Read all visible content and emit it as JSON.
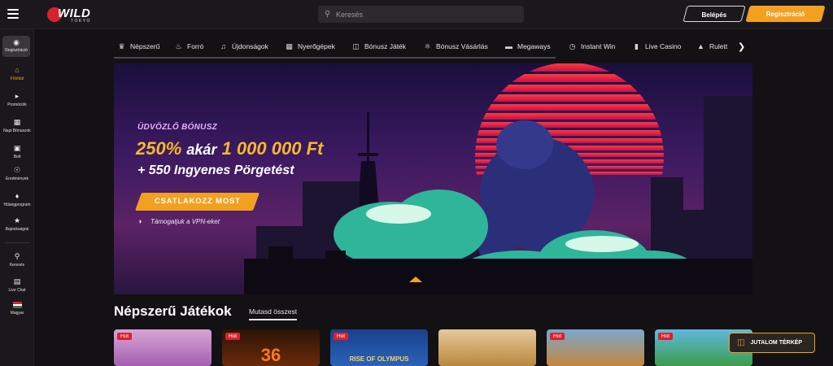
{
  "header": {
    "logo_main": "WILD",
    "logo_sub": "TOKYO",
    "search_placeholder": "Keresés",
    "login_label": "Belépés",
    "register_label": "Regisztráció"
  },
  "sidebar": {
    "register": "Regisztráció",
    "items": [
      {
        "label": "Főoldal",
        "icon": "home-icon",
        "active": true
      },
      {
        "label": "Promóciók",
        "icon": "megaphone-icon"
      },
      {
        "label": "Napi Bónuszok",
        "icon": "calendar-icon"
      },
      {
        "label": "Bolt",
        "icon": "shop-icon"
      },
      {
        "label": "Eredmények",
        "icon": "achievements-icon"
      },
      {
        "label": "Hűségprogram",
        "icon": "loyalty-icon"
      },
      {
        "label": "Bajnokságok",
        "icon": "trophy-icon"
      }
    ],
    "lower": [
      {
        "label": "Keresés",
        "icon": "search-icon"
      },
      {
        "label": "Live Chat",
        "icon": "chat-icon"
      },
      {
        "label": "Magyar",
        "icon": "hungary-flag-icon"
      }
    ]
  },
  "categories": [
    {
      "label": "Népszerű",
      "icon": "crown-icon"
    },
    {
      "label": "Forró",
      "icon": "flame-icon"
    },
    {
      "label": "Újdonságok",
      "icon": "bell-icon"
    },
    {
      "label": "Nyerőgépek",
      "icon": "slot-icon"
    },
    {
      "label": "Bónusz Játék",
      "icon": "gift-icon"
    },
    {
      "label": "Bónusz Vásárlás",
      "icon": "bonus-buy-icon"
    },
    {
      "label": "Megaways",
      "icon": "megaways-icon"
    },
    {
      "label": "Instant Win",
      "icon": "timer-icon"
    },
    {
      "label": "Live Casino",
      "icon": "live-casino-icon"
    },
    {
      "label": "Rulett",
      "icon": "roulette-icon"
    }
  ],
  "banner": {
    "welcome": "ÜDVÖZLŐ BÓNUSZ",
    "amount": "250%",
    "up_to": "akár",
    "prize": "1 000 000 Ft",
    "spins": "+ 550 Ingyenes Pörgetést",
    "cta": "CSATLAKOZZ MOST",
    "vpn": "Támogatjuk a VPN-eket"
  },
  "popular": {
    "title": "Népszerű Játékok",
    "show_all": "Mutasd összest",
    "games": [
      {
        "badge": "Hot",
        "caption": ""
      },
      {
        "badge": "Hot",
        "caption": "36"
      },
      {
        "badge": "Hot",
        "caption": "RISE OF OLYMPUS"
      },
      {
        "badge": "",
        "caption": ""
      },
      {
        "badge": "Hot",
        "caption": ""
      },
      {
        "badge": "Hot",
        "caption": ""
      }
    ]
  },
  "reward_map": "JUTALOM TÉRKÉP",
  "colors": {
    "accent": "#f2a020",
    "hot": "#d8232d",
    "background": "#131114"
  }
}
